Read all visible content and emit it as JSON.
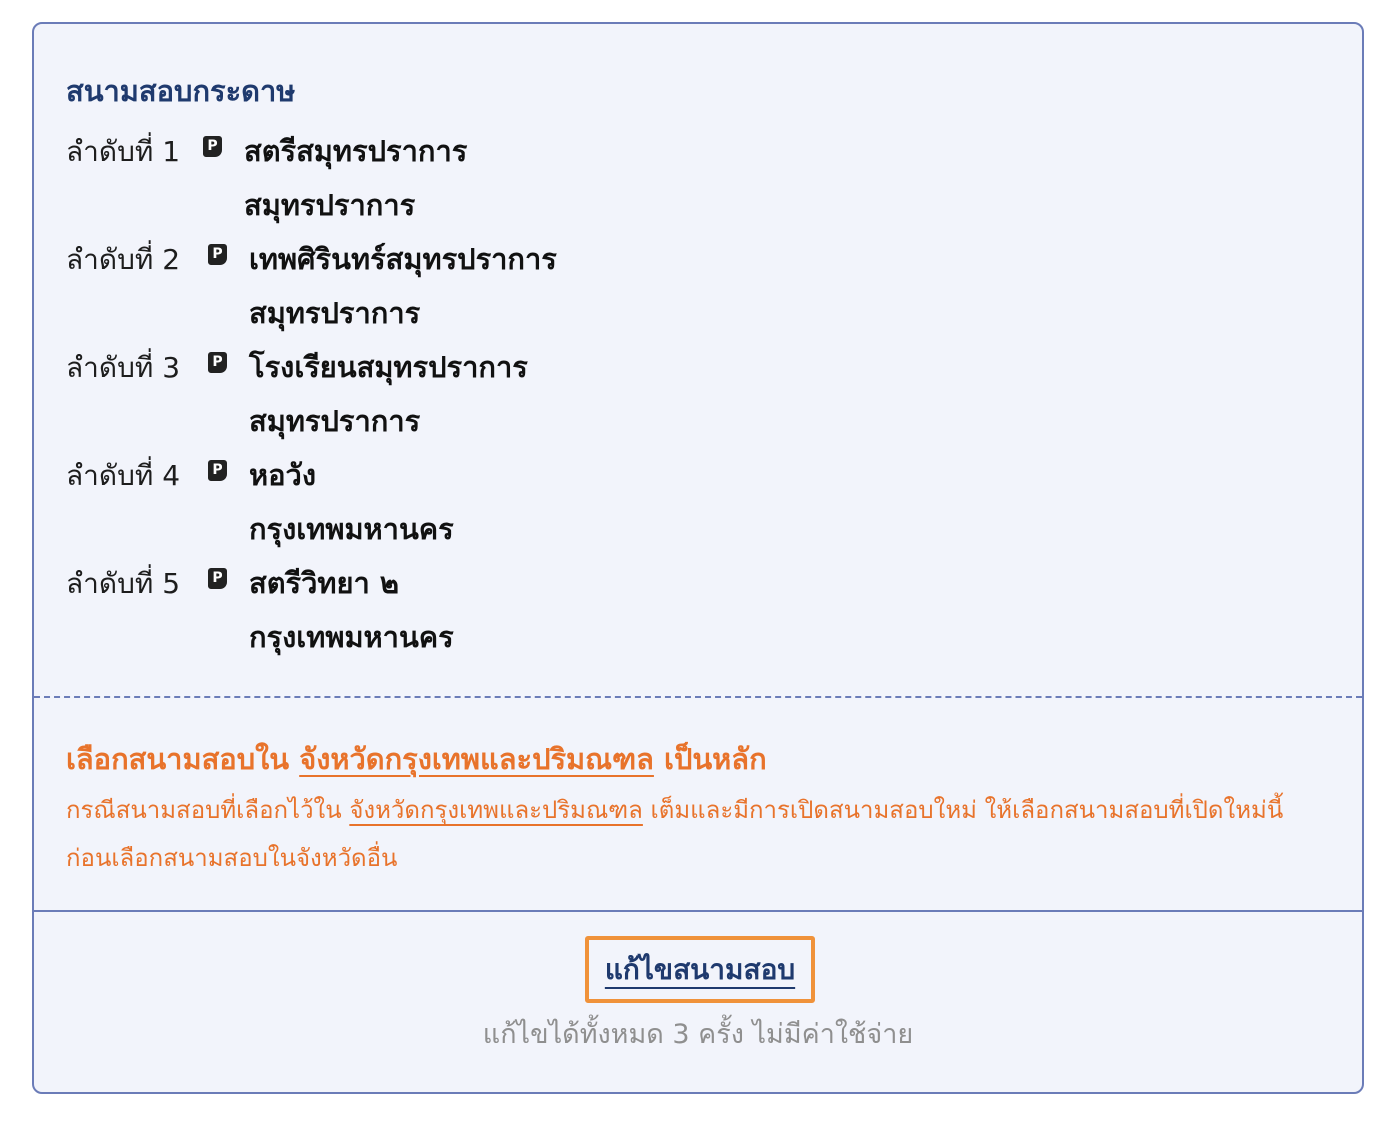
{
  "section": {
    "title": "สนามสอบกระดาษ"
  },
  "venue_icon": {
    "name": "paper-exam-icon",
    "glyph": "P"
  },
  "venues": [
    {
      "rank": "ลำดับที่ 1",
      "name": "สตรีสมุทรปราการ",
      "province": "สมุทรปราการ"
    },
    {
      "rank": "ลำดับที่ 2",
      "name": "เทพศิรินทร์สมุทรปราการ",
      "province": "สมุทรปราการ"
    },
    {
      "rank": "ลำดับที่ 3",
      "name": "โรงเรียนสมุทรปราการ",
      "province": "สมุทรปราการ"
    },
    {
      "rank": "ลำดับที่ 4",
      "name": "หอวัง",
      "province": "กรุงเทพมหานคร"
    },
    {
      "rank": "ลำดับที่ 5",
      "name": "สตรีวิทยา ๒",
      "province": "กรุงเทพมหานคร"
    }
  ],
  "notice": {
    "title_prefix": "เลือกสนามสอบใน",
    "title_region": "จังหวัดกรุงเทพและปริมณฑล",
    "title_suffix": "เป็นหลัก",
    "body_prefix": "กรณีสนามสอบที่เลือกไว้ใน",
    "body_region": "จังหวัดกรุงเทพและปริมณฑล",
    "body_suffix": "เต็มและมีการเปิดสนามสอบใหม่ ให้เลือกสนามสอบที่เปิดใหม่นี้ก่อนเลือกสนามสอบในจังหวัดอื่น"
  },
  "actions": {
    "edit_label": "แก้ไขสนามสอบ",
    "edit_note": "แก้ไขได้ทั้งหมด 3 ครั้ง ไม่มีค่าใช้จ่าย"
  },
  "colors": {
    "card_background": "#f2f4fb",
    "border": "#6b7cb8",
    "title_navy": "#1f3a6e",
    "accent_orange": "#e8732b",
    "button_border": "#f0923a",
    "muted_gray": "#8f8f8f"
  }
}
